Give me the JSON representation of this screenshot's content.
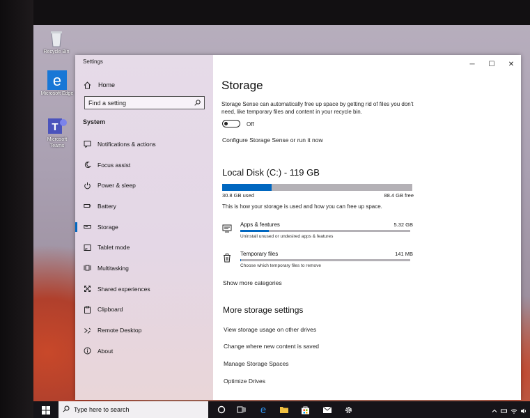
{
  "desktop": {
    "icons": [
      {
        "label": "Recycle Bin"
      },
      {
        "label": "Microsoft Edge"
      },
      {
        "label": "Microsoft Teams"
      }
    ]
  },
  "window": {
    "title": "Settings",
    "controls": {
      "minimize": "─",
      "maximize": "☐",
      "close": "✕"
    }
  },
  "sidebar": {
    "home_label": "Home",
    "search_placeholder": "Find a setting",
    "section": "System",
    "items": [
      {
        "label": "Notifications & actions",
        "icon": "notification-icon"
      },
      {
        "label": "Focus assist",
        "icon": "moon-icon"
      },
      {
        "label": "Power & sleep",
        "icon": "power-icon"
      },
      {
        "label": "Battery",
        "icon": "battery-icon"
      },
      {
        "label": "Storage",
        "icon": "storage-icon",
        "active": true
      },
      {
        "label": "Tablet mode",
        "icon": "tablet-icon"
      },
      {
        "label": "Multitasking",
        "icon": "multitasking-icon"
      },
      {
        "label": "Shared experiences",
        "icon": "shared-icon"
      },
      {
        "label": "Clipboard",
        "icon": "clipboard-icon"
      },
      {
        "label": "Remote Desktop",
        "icon": "remote-icon"
      },
      {
        "label": "About",
        "icon": "info-icon"
      }
    ]
  },
  "main": {
    "title": "Storage",
    "description": "Storage Sense can automatically free up space by getting rid of files you don't need, like temporary files and content in your recycle bin.",
    "toggle_state": "Off",
    "configure_link": "Configure Storage Sense or run it now",
    "disk": {
      "title": "Local Disk (C:) - 119 GB",
      "used_label": "30.8 GB used",
      "free_label": "88.4 GB free",
      "used_fraction": 0.26,
      "caption": "This is how your storage is used and how you can free up space."
    },
    "categories": [
      {
        "name": "Apps & features",
        "size": "5.32 GB",
        "hint": "Uninstall unused or undesired apps & features",
        "fraction": 0.17
      },
      {
        "name": "Temporary files",
        "size": "141 MB",
        "hint": "Choose which temporary files to remove",
        "fraction": 0.005
      }
    ],
    "show_more": "Show more categories",
    "more_title": "More storage settings",
    "more_links": [
      "View storage usage on other drives",
      "Change where new content is saved",
      "Manage Storage Spaces",
      "Optimize Drives"
    ]
  },
  "taskbar": {
    "search_placeholder": "Type here to search"
  },
  "colors": {
    "accent": "#0067c0",
    "bar_track": "#b4b1b6"
  }
}
